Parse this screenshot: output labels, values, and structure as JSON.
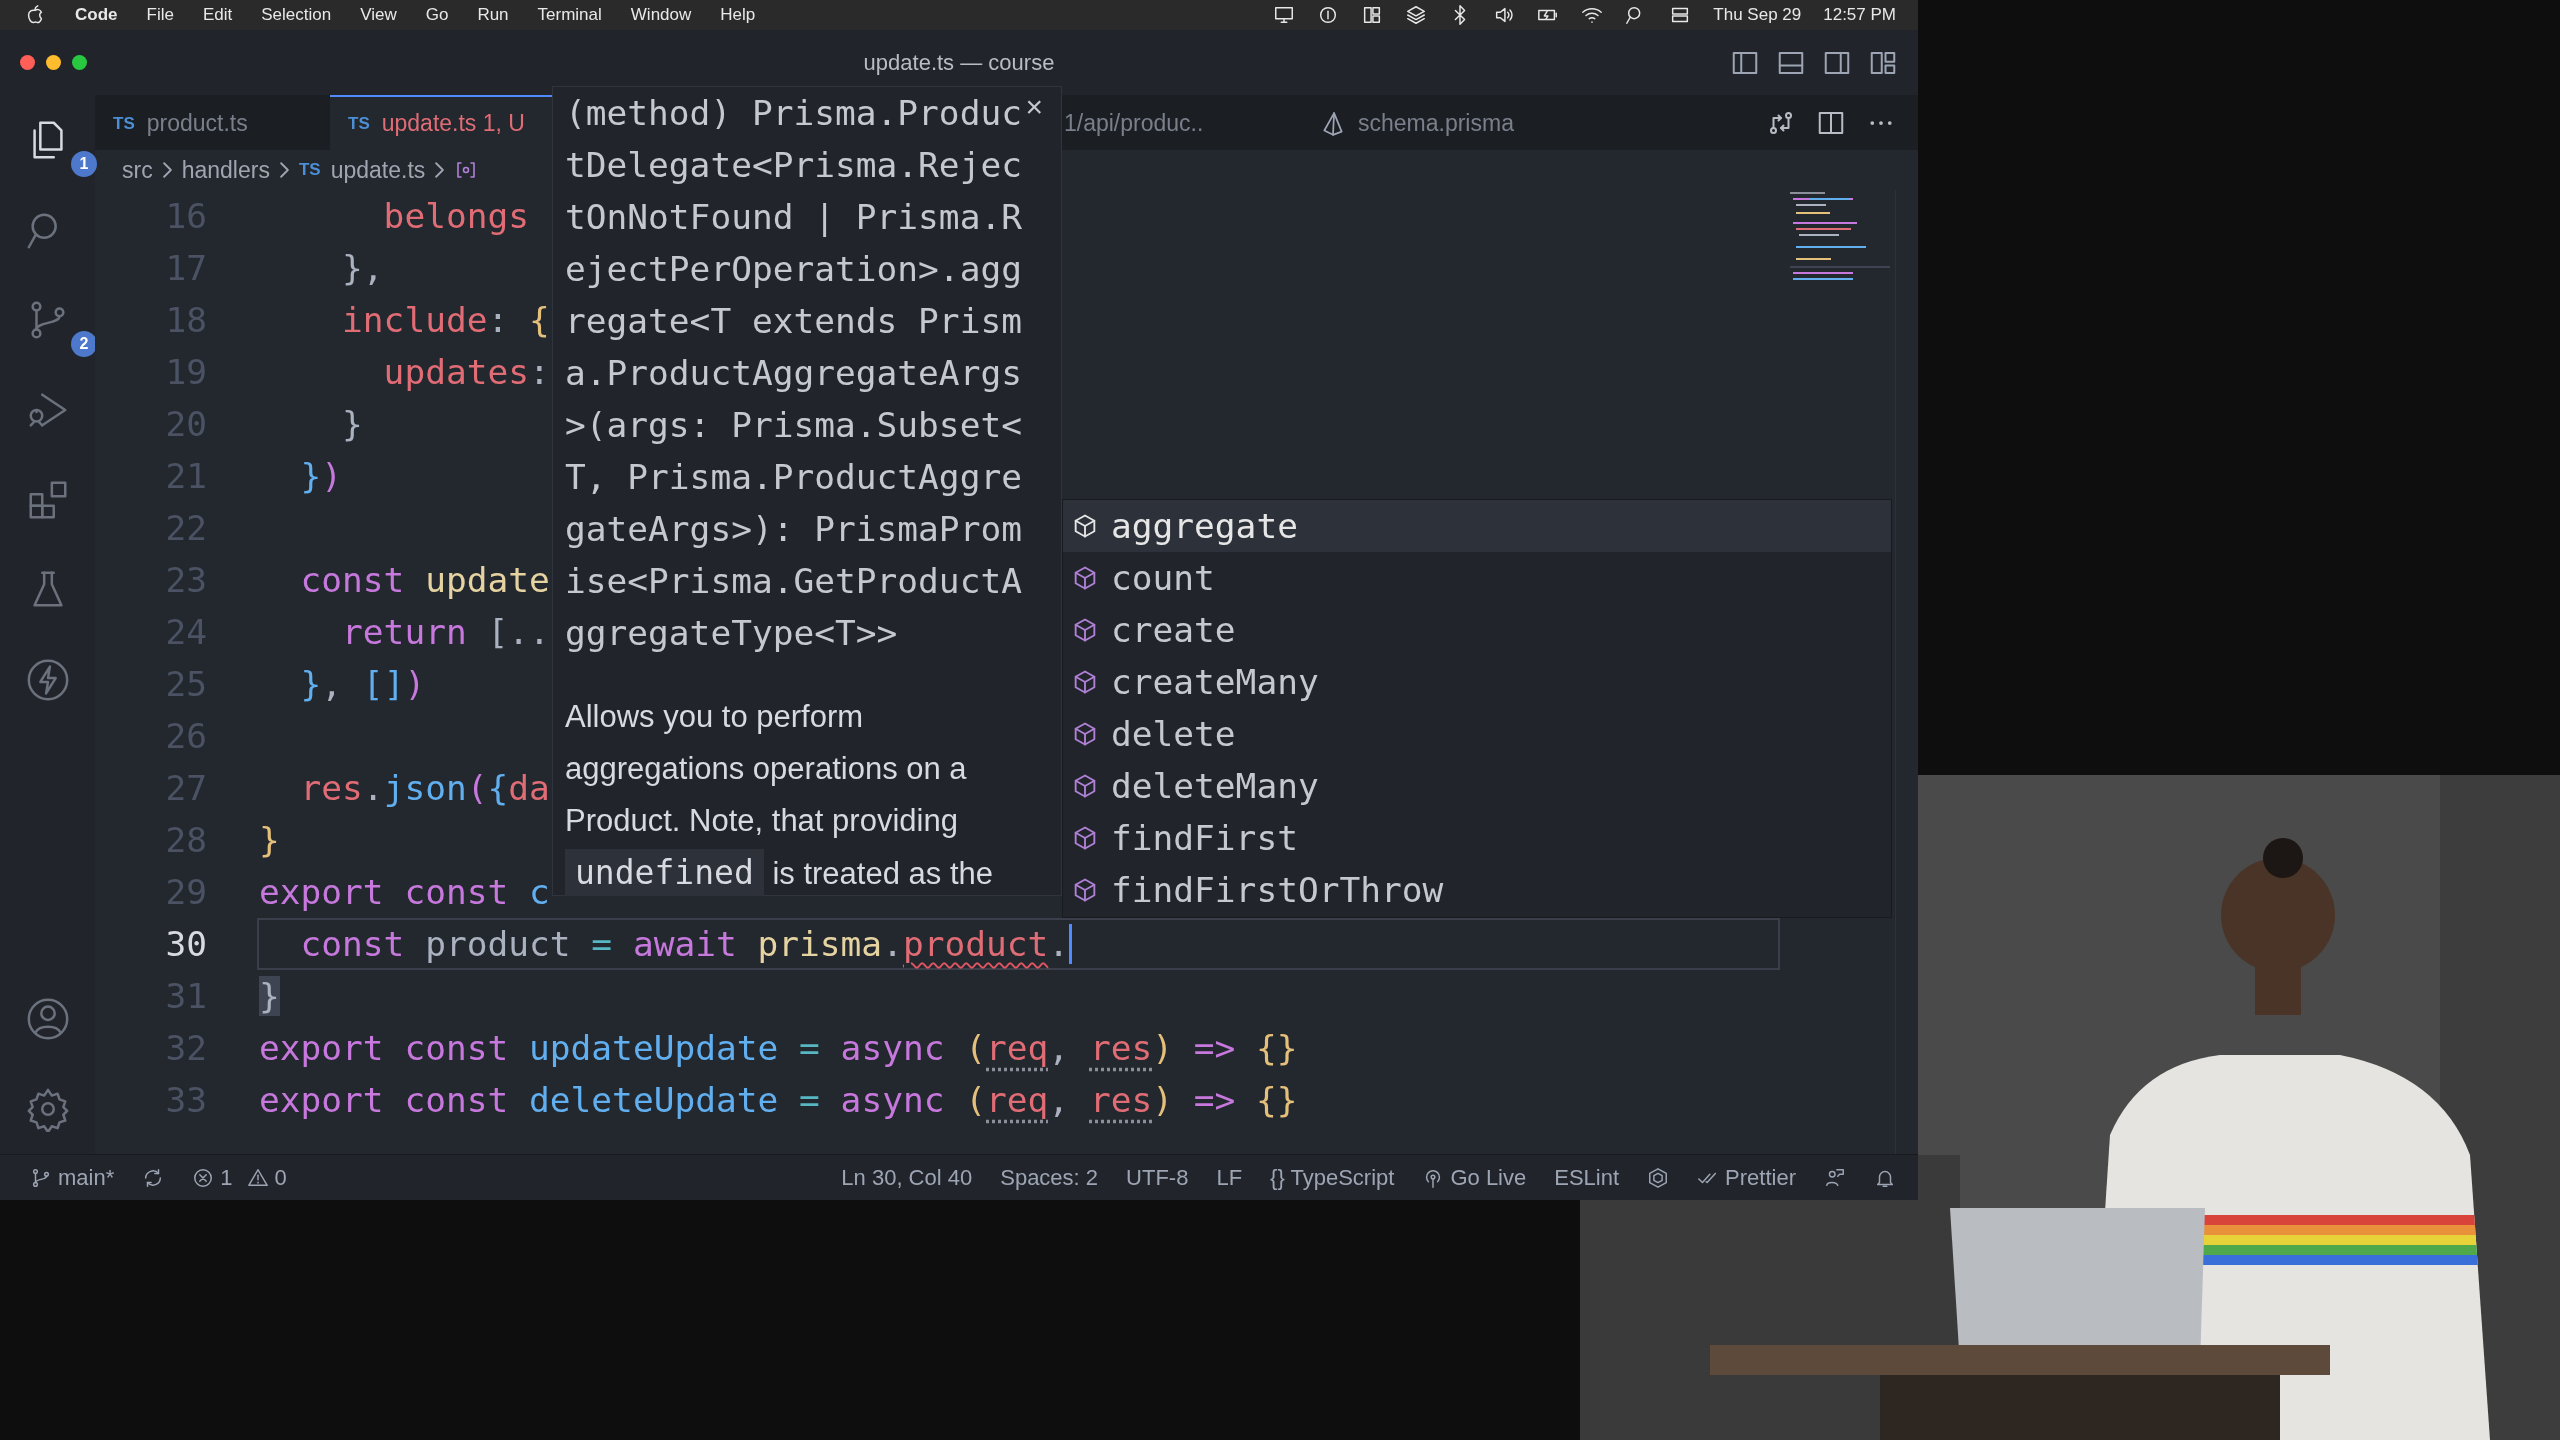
{
  "menu_bar": {
    "items": [
      {
        "label": "Code",
        "kind": "app"
      },
      {
        "label": "File",
        "kind": "menu"
      },
      {
        "label": "Edit",
        "kind": "menu"
      },
      {
        "label": "Selection",
        "kind": "menu"
      },
      {
        "label": "View",
        "kind": "menu"
      },
      {
        "label": "Go",
        "kind": "menu"
      },
      {
        "label": "Run",
        "kind": "menu"
      },
      {
        "label": "Terminal",
        "kind": "menu"
      },
      {
        "label": "Window",
        "kind": "menu"
      },
      {
        "label": "Help",
        "kind": "menu"
      }
    ],
    "date": "Thu Sep 29",
    "time": "12:57 PM"
  },
  "window": {
    "title": "update.ts — course"
  },
  "activity": {
    "top": [
      {
        "kind": "files",
        "selected": true,
        "badge": "1"
      },
      {
        "kind": "search",
        "selected": false
      },
      {
        "kind": "source-control",
        "selected": false,
        "badge": "2"
      },
      {
        "kind": "run-debug",
        "selected": false
      },
      {
        "kind": "extensions",
        "selected": false
      },
      {
        "kind": "testing",
        "selected": false
      },
      {
        "kind": "lightning",
        "selected": false
      }
    ],
    "bottom": [
      {
        "kind": "account",
        "selected": false
      },
      {
        "kind": "gear",
        "selected": false
      }
    ]
  },
  "tabs": [
    {
      "kind": "ts",
      "lang": "TS",
      "label": "product.ts",
      "selected": false,
      "error": false
    },
    {
      "kind": "ts",
      "lang": "TS",
      "label": "update.ts",
      "detail": "1, U",
      "selected": true,
      "error": true
    },
    {
      "kind": "plain",
      "label": "1/api/produc..",
      "selected": false,
      "error": false
    },
    {
      "kind": "prisma",
      "label": "schema.prisma",
      "selected": false,
      "error": false
    }
  ],
  "breadcrumbs": [
    {
      "kind": "folder",
      "label": "src"
    },
    {
      "kind": "folder",
      "label": "handlers"
    },
    {
      "kind": "ts",
      "lang": "TS",
      "label": "update.ts"
    },
    {
      "kind": "symbol"
    }
  ],
  "code": {
    "lines": [
      {
        "number": "16",
        "selected": false,
        "tokens": [
          {
            "t": "      belongs",
            "kind": "prop"
          }
        ]
      },
      {
        "number": "17",
        "selected": false,
        "tokens": [
          {
            "t": "    }",
            "kind": "plain"
          },
          {
            "t": ",",
            "kind": "plain"
          }
        ]
      },
      {
        "number": "18",
        "selected": false,
        "tokens": [
          {
            "t": "    include",
            "kind": "prop"
          },
          {
            "t": ": ",
            "kind": "plain"
          },
          {
            "t": "{",
            "kind": "b1"
          }
        ]
      },
      {
        "number": "19",
        "selected": false,
        "tokens": [
          {
            "t": "      updates",
            "kind": "prop"
          },
          {
            "t": ":",
            "kind": "plain"
          }
        ]
      },
      {
        "number": "20",
        "selected": false,
        "tokens": [
          {
            "t": "    }",
            "kind": "plain"
          }
        ]
      },
      {
        "number": "21",
        "selected": false,
        "tokens": [
          {
            "t": "  }",
            "kind": "b3"
          },
          {
            "t": ")",
            "kind": "b2"
          }
        ]
      },
      {
        "number": "22",
        "selected": false
      },
      {
        "number": "23",
        "selected": false,
        "tokens": [
          {
            "t": "  const ",
            "kind": "kw"
          },
          {
            "t": "update",
            "kind": "var"
          }
        ]
      },
      {
        "number": "24",
        "selected": false,
        "tokens": [
          {
            "t": "    return ",
            "kind": "kw"
          },
          {
            "t": "[..",
            "kind": "plain"
          }
        ]
      },
      {
        "number": "25",
        "selected": false,
        "tokens": [
          {
            "t": "  }",
            "kind": "b3"
          },
          {
            "t": ", ",
            "kind": "plain"
          },
          {
            "t": "[]",
            "kind": "b3"
          },
          {
            "t": ")",
            "kind": "b2"
          }
        ]
      },
      {
        "number": "26",
        "selected": false
      },
      {
        "number": "27",
        "selected": false,
        "tokens": [
          {
            "t": "  res",
            "kind": "prop"
          },
          {
            "t": ".",
            "kind": "plain"
          },
          {
            "t": "json",
            "kind": "fn"
          },
          {
            "t": "(",
            "kind": "b2"
          },
          {
            "t": "{",
            "kind": "b3"
          },
          {
            "t": "da",
            "kind": "prop"
          }
        ]
      },
      {
        "number": "28",
        "selected": false,
        "tokens": [
          {
            "t": "}",
            "kind": "b1"
          }
        ]
      },
      {
        "number": "29",
        "selected": false,
        "tokens": [
          {
            "t": "export const ",
            "kind": "kw"
          },
          {
            "t": "c",
            "kind": "fn"
          }
        ]
      },
      {
        "number": "30",
        "selected": true,
        "tokens": [
          {
            "t": "  const ",
            "kind": "kw"
          },
          {
            "t": "product ",
            "kind": "plain"
          },
          {
            "t": "= ",
            "kind": "op"
          },
          {
            "t": "await ",
            "kind": "kw"
          },
          {
            "t": "prisma",
            "kind": "var"
          },
          {
            "t": ".",
            "kind": "plain"
          },
          {
            "t": "product",
            "kind": "prop",
            "error": true
          },
          {
            "t": ".",
            "kind": "plain"
          }
        ]
      },
      {
        "number": "31",
        "selected": false,
        "tokens": [
          {
            "t": "}",
            "kind": "match"
          }
        ]
      },
      {
        "number": "32",
        "selected": false,
        "tokens": [
          {
            "t": "export const ",
            "kind": "kw"
          },
          {
            "t": "updateUpdate ",
            "kind": "fn"
          },
          {
            "t": "= ",
            "kind": "op"
          },
          {
            "t": "async ",
            "kind": "kw"
          },
          {
            "t": "(",
            "kind": "b1"
          },
          {
            "t": "req",
            "kind": "param"
          },
          {
            "t": ", ",
            "kind": "plain"
          },
          {
            "t": "res",
            "kind": "param"
          },
          {
            "t": ") ",
            "kind": "b1"
          },
          {
            "t": "=> ",
            "kind": "kw"
          },
          {
            "t": "{}",
            "kind": "b1"
          }
        ]
      },
      {
        "number": "33",
        "selected": false,
        "tokens": [
          {
            "t": "export const ",
            "kind": "kw"
          },
          {
            "t": "deleteUpdate ",
            "kind": "fn"
          },
          {
            "t": "= ",
            "kind": "op"
          },
          {
            "t": "async ",
            "kind": "kw"
          },
          {
            "t": "(",
            "kind": "b1"
          },
          {
            "t": "req",
            "kind": "param"
          },
          {
            "t": ", ",
            "kind": "plain"
          },
          {
            "t": "res",
            "kind": "param"
          },
          {
            "t": ") ",
            "kind": "b1"
          },
          {
            "t": "=> ",
            "kind": "kw"
          },
          {
            "t": "{}",
            "kind": "b1"
          }
        ]
      }
    ]
  },
  "hover": {
    "close": "×",
    "signature": [
      "(method) Prisma.Produc",
      "tDelegate<Prisma.Rejec",
      "tOnNotFound | Prisma.R",
      "ejectPerOperation>.agg",
      "regate<T extends Prism",
      "a.ProductAggregateArgs",
      ">(args: Prisma.Subset<",
      "T, Prisma.ProductAggre",
      "gateArgs>): PrismaProm",
      "ise<Prisma.GetProductA",
      "ggregateType<T>>"
    ],
    "doc": [
      [
        {
          "t": "Allows you to perform",
          "kind": "text"
        }
      ],
      [
        {
          "t": "aggregations operations on a",
          "kind": "text"
        }
      ],
      [
        {
          "t": "Product. Note, that providing",
          "kind": "text"
        }
      ],
      [
        {
          "t": "undefined",
          "kind": "code"
        },
        {
          "t": " is treated as the",
          "kind": "text"
        }
      ]
    ]
  },
  "suggest": {
    "items": [
      {
        "label": "aggregate",
        "selected": true
      },
      {
        "label": "count",
        "selected": false
      },
      {
        "label": "create",
        "selected": false
      },
      {
        "label": "createMany",
        "selected": false
      },
      {
        "label": "delete",
        "selected": false
      },
      {
        "label": "deleteMany",
        "selected": false
      },
      {
        "label": "findFirst",
        "selected": false
      },
      {
        "label": "findFirstOrThrow",
        "selected": false
      }
    ]
  },
  "status_bar": {
    "branch": "main*",
    "errors": "1",
    "warnings": "0",
    "right": [
      {
        "kind": "plain",
        "text": "Ln 30, Col 40"
      },
      {
        "kind": "plain",
        "text": "Spaces: 2"
      },
      {
        "kind": "plain",
        "text": "UTF-8"
      },
      {
        "kind": "plain",
        "text": "LF"
      },
      {
        "kind": "plain",
        "text": "{} TypeScript"
      },
      {
        "kind": "live",
        "text": "Go Live"
      },
      {
        "kind": "plain",
        "text": "ESLint"
      },
      {
        "kind": "hex"
      },
      {
        "kind": "prettier",
        "text": "Prettier"
      },
      {
        "kind": "feedback"
      },
      {
        "kind": "bell"
      }
    ]
  }
}
